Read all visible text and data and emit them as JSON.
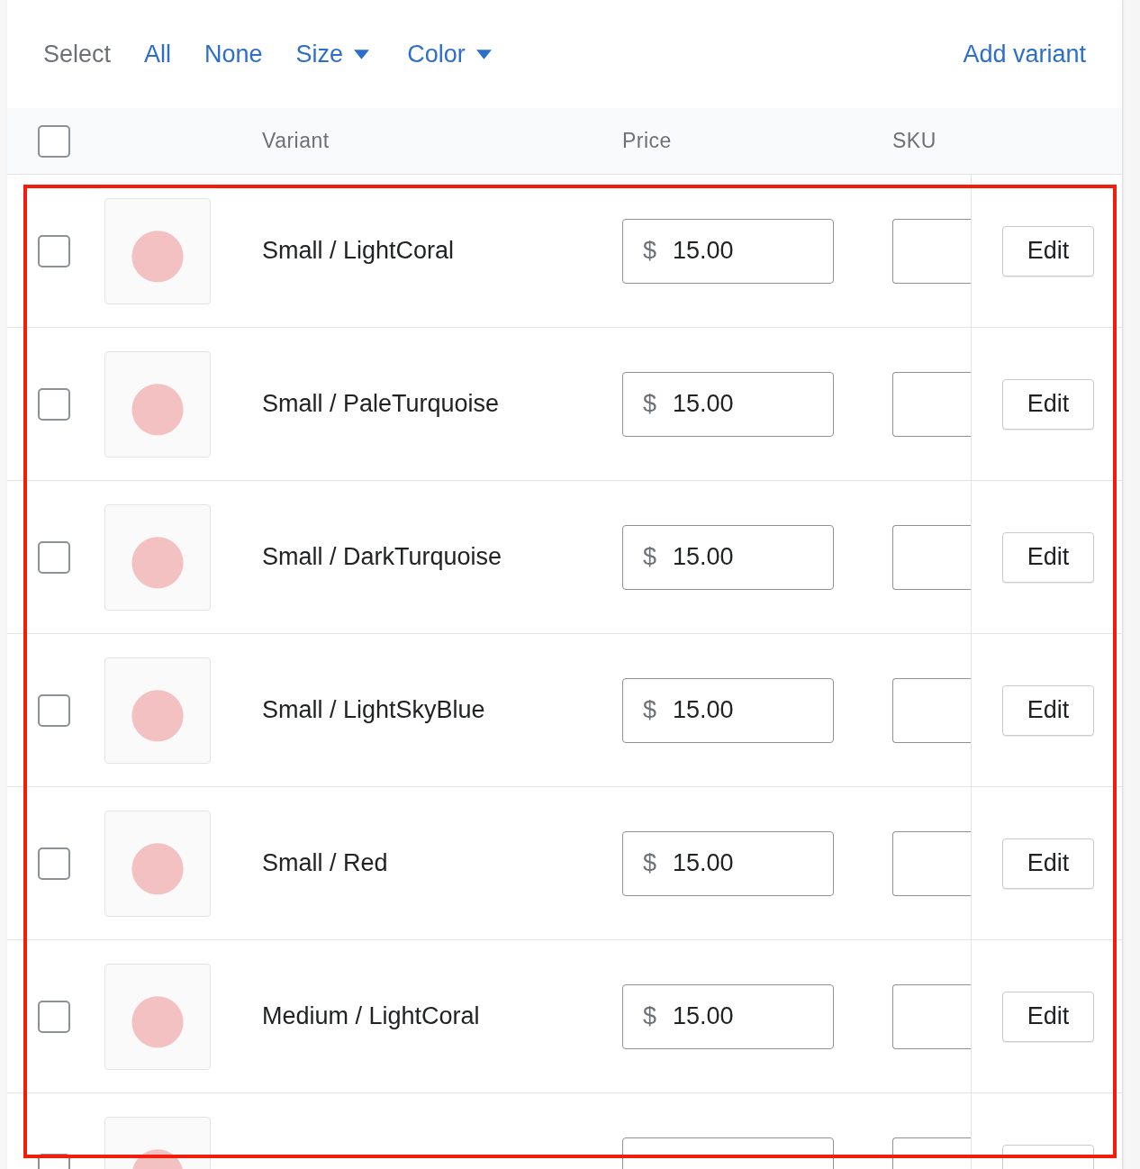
{
  "toolbar": {
    "select_label": "Select",
    "links": [
      {
        "label": "All"
      },
      {
        "label": "None"
      }
    ],
    "filters": [
      {
        "label": "Size"
      },
      {
        "label": "Color"
      }
    ],
    "add_variant": "Add variant"
  },
  "table": {
    "select_all": {
      "checked": false
    },
    "columns": [
      "Variant",
      "Price",
      "SKU"
    ],
    "rows": [
      {
        "checked": false,
        "variant": "Small / LightCoral",
        "currency": "$",
        "price": "15.00",
        "action": "Edit"
      },
      {
        "checked": false,
        "variant": "Small / PaleTurquoise",
        "currency": "$",
        "price": "15.00",
        "action": "Edit"
      },
      {
        "checked": false,
        "variant": "Small / DarkTurquoise",
        "currency": "$",
        "price": "15.00",
        "action": "Edit"
      },
      {
        "checked": false,
        "variant": "Small / LightSkyBlue",
        "currency": "$",
        "price": "15.00",
        "action": "Edit"
      },
      {
        "checked": false,
        "variant": "Small / Red",
        "currency": "$",
        "price": "15.00",
        "action": "Edit"
      },
      {
        "checked": false,
        "variant": "Medium / LightCoral",
        "currency": "$",
        "price": "15.00",
        "action": "Edit"
      },
      {
        "checked": false
      }
    ]
  }
}
